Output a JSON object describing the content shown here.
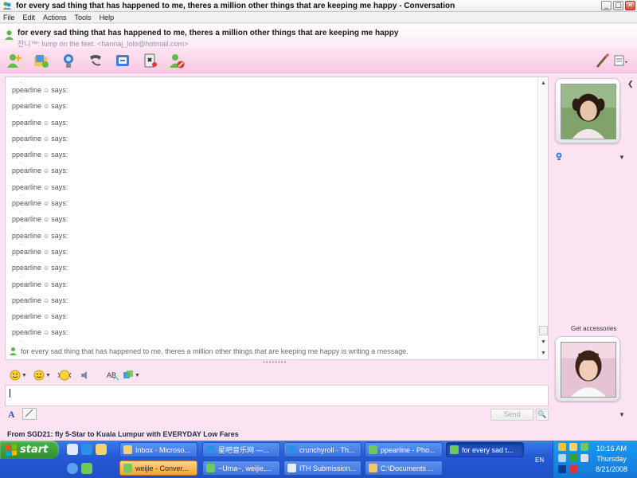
{
  "window": {
    "title": "for every sad thing that has happened to me, theres a million other things that are keeping me happy - Conversation",
    "controls": {
      "minimize": "_",
      "maximize": "□",
      "close": "✕"
    }
  },
  "menu": {
    "items": [
      "File",
      "Edit",
      "Actions",
      "Tools",
      "Help"
    ]
  },
  "header": {
    "subject": "for every sad thing that has happened to me, theres a million other things that are keeping me happy",
    "contact": "잔니™: lump on the feet. <hannaj_lolo@hotmail.com>"
  },
  "toolbar": {
    "icons": [
      "invite-contact-icon",
      "send-files-icon",
      "video-call-icon",
      "voice-call-icon",
      "activities-icon",
      "games-icon",
      "block-icon",
      "paint-icon",
      "display-options-icon"
    ]
  },
  "conversation": {
    "messages": [
      {
        "dot": ".",
        "sender": "ppearline",
        "emoticon": "☺",
        "verb": "says:"
      },
      {
        "dot": ".",
        "sender": "ppearline",
        "emoticon": "☺",
        "verb": "says:"
      },
      {
        "dot": ".",
        "sender": "ppearline",
        "emoticon": "☺",
        "verb": "says:"
      },
      {
        "dot": ".",
        "sender": "ppearline",
        "emoticon": "☺",
        "verb": "says:"
      },
      {
        "dot": ".",
        "sender": "ppearline",
        "emoticon": "☺",
        "verb": "says:"
      },
      {
        "dot": ".",
        "sender": "ppearline",
        "emoticon": "☺",
        "verb": "says:"
      },
      {
        "dot": ".",
        "sender": "ppearline",
        "emoticon": "☺",
        "verb": "says:"
      },
      {
        "dot": ".",
        "sender": "ppearline",
        "emoticon": "☺",
        "verb": "says:"
      },
      {
        "dot": ".",
        "sender": "ppearline",
        "emoticon": "☺",
        "verb": "says:"
      },
      {
        "dot": ".",
        "sender": "ppearline",
        "emoticon": "☺",
        "verb": "says:"
      },
      {
        "dot": ".",
        "sender": "ppearline",
        "emoticon": "☺",
        "verb": "says:"
      },
      {
        "dot": ".",
        "sender": "ppearline",
        "emoticon": "☺",
        "verb": "says:"
      },
      {
        "dot": ".",
        "sender": "ppearline",
        "emoticon": "☺",
        "verb": "says:"
      },
      {
        "dot": ".",
        "sender": "ppearline",
        "emoticon": "☺",
        "verb": "says:"
      },
      {
        "dot": ".",
        "sender": "ppearline",
        "emoticon": "☺",
        "verb": "says:"
      },
      {
        "dot": ".",
        "sender": "ppearline",
        "emoticon": "☺",
        "verb": "says:"
      }
    ],
    "typing_status": "for every sad thing that has happened to me, theres a million other things that are keeping me happy is writing a message.",
    "trailing_dot": "."
  },
  "compose": {
    "font_button": "A",
    "send_label": "Send",
    "search_label": "🔍",
    "splitter": "••••••••"
  },
  "ad": {
    "text": "From SGD21: fly 5-Star to Kuala Lumpur with EVERYDAY Low Fares"
  },
  "side_panel": {
    "get_accessories": "Get accessories"
  },
  "colors": {
    "accent_pink": "#f8c9e3",
    "taskbar_blue": "#245bd6",
    "start_green": "#3a9e3a"
  },
  "taskbar": {
    "start_label": "start",
    "tasks_row1": [
      {
        "label": "Inbox - Microso...",
        "icon": "outlook-icon"
      },
      {
        "label": "星吧音乐网 —...",
        "icon": "browser-icon"
      },
      {
        "label": "crunchyroll - Th...",
        "icon": "browser-icon"
      },
      {
        "label": "ppearline - Pho...",
        "icon": "msn-icon"
      },
      {
        "label": "for every sad t...",
        "icon": "msn-icon"
      }
    ],
    "tasks_row2": [
      {
        "label": "weijie - Conver...",
        "icon": "msn-icon"
      },
      {
        "label": "~Uma~, weijie,...",
        "icon": "msn-icon"
      },
      {
        "label": "ITH Submission...",
        "icon": "app-icon"
      },
      {
        "label": "C:\\Documents ...",
        "icon": "folder-icon"
      }
    ],
    "language": "EN",
    "clock": {
      "time": "10:16 AM",
      "day": "Thursday",
      "date": "8/21/2008"
    }
  }
}
